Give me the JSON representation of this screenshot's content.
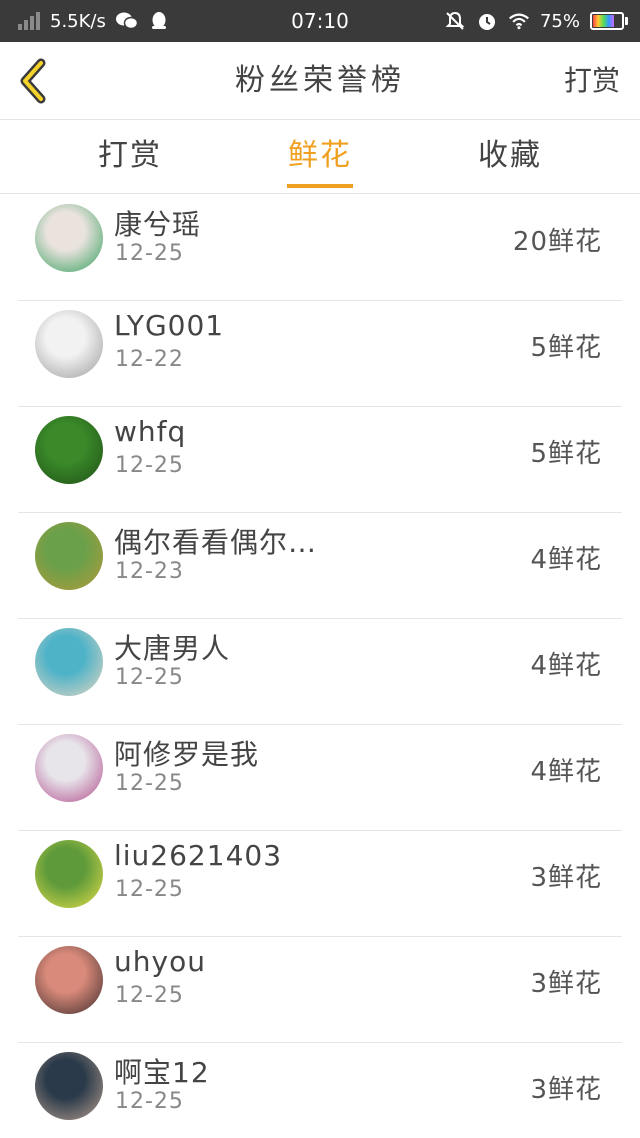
{
  "status_bar": {
    "net_speed": "5.5K/s",
    "time": "07:10",
    "battery": "75%",
    "battery_level": 0.75,
    "icons": [
      "signal-icon",
      "wechat-icon",
      "qq-icon",
      "mute-icon",
      "alarm-icon",
      "wifi-icon",
      "battery-icon"
    ]
  },
  "header": {
    "title": "粉丝荣誉榜",
    "action_label": "打赏",
    "back_icon": "chevron-left-icon"
  },
  "tabs": [
    {
      "label": "打赏"
    },
    {
      "label": "鲜花",
      "active": true
    },
    {
      "label": "收藏"
    }
  ],
  "list": [
    {
      "name": "康兮瑶",
      "date": "12-25",
      "count": "20鲜花",
      "avatar_colors": [
        "#e9e2dd",
        "#2f9e5a"
      ]
    },
    {
      "name": "LYG001",
      "date": "12-22",
      "count": "5鲜花",
      "avatar_colors": [
        "#f2f2f2",
        "#9a9a9a"
      ]
    },
    {
      "name": "whfq",
      "date": "12-25",
      "count": "5鲜花",
      "avatar_colors": [
        "#3a8a2a",
        "#1f4f16"
      ]
    },
    {
      "name": "偶尔看看偶尔…",
      "date": "12-23",
      "count": "4鲜花",
      "avatar_colors": [
        "#6aa04a",
        "#b59a3a"
      ]
    },
    {
      "name": "大唐男人",
      "date": "12-25",
      "count": "4鲜花",
      "avatar_colors": [
        "#4fb3c8",
        "#e8d7c2"
      ]
    },
    {
      "name": "阿修罗是我",
      "date": "12-25",
      "count": "4鲜花",
      "avatar_colors": [
        "#e7e4ea",
        "#b04a8a"
      ]
    },
    {
      "name": "liu2621403",
      "date": "12-25",
      "count": "3鲜花",
      "avatar_colors": [
        "#5e9a3a",
        "#e6e04a"
      ]
    },
    {
      "name": "uhyou",
      "date": "12-25",
      "count": "3鲜花",
      "avatar_colors": [
        "#d98a7a",
        "#3a2a2a"
      ]
    },
    {
      "name": "啊宝12",
      "date": "12-25",
      "count": "3鲜花",
      "avatar_colors": [
        "#2a3a4a",
        "#b8a090"
      ]
    }
  ]
}
